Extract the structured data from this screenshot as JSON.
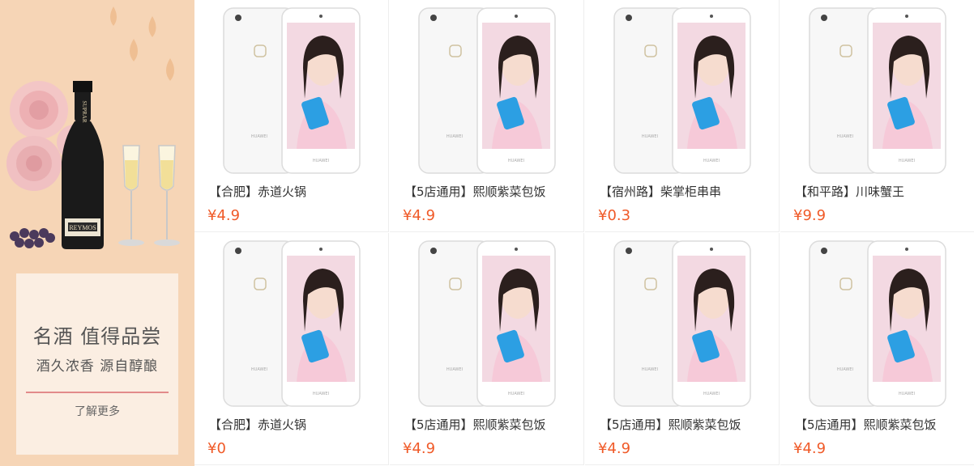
{
  "banner": {
    "title": "名酒 值得品尝",
    "subtitle": "酒久浓香 源自醇酿",
    "more_link": "了解更多",
    "bottle_label": "REYMOS",
    "bottle_neck_label": "SUPRAR",
    "bg_color": "#f6d5b6",
    "card_color": "#fbeee2",
    "accent_color": "#e28a8a"
  },
  "products": [
    {
      "name": "【合肥】赤道火锅",
      "price": "¥4.9",
      "phone_brand": "HUAWEI"
    },
    {
      "name": "【5店通用】熙顺紫菜包饭",
      "price": "¥4.9",
      "phone_brand": "HUAWEI"
    },
    {
      "name": "【宿州路】柴掌柜串串",
      "price": "¥0.3",
      "phone_brand": "HUAWEI"
    },
    {
      "name": "【和平路】川味蟹王",
      "price": "¥9.9",
      "phone_brand": "HUAWEI"
    },
    {
      "name": "【合肥】赤道火锅",
      "price": "¥0",
      "phone_brand": "HUAWEI"
    },
    {
      "name": "【5店通用】熙顺紫菜包饭",
      "price": "¥4.9",
      "phone_brand": "HUAWEI"
    },
    {
      "name": "【5店通用】熙顺紫菜包饭",
      "price": "¥4.9",
      "phone_brand": "HUAWEI"
    },
    {
      "name": "【5店通用】熙顺紫菜包饭",
      "price": "¥4.9",
      "phone_brand": "HUAWEI"
    }
  ],
  "colors": {
    "price": "#f05a28",
    "name": "#333333",
    "divider": "#eeeeee"
  }
}
